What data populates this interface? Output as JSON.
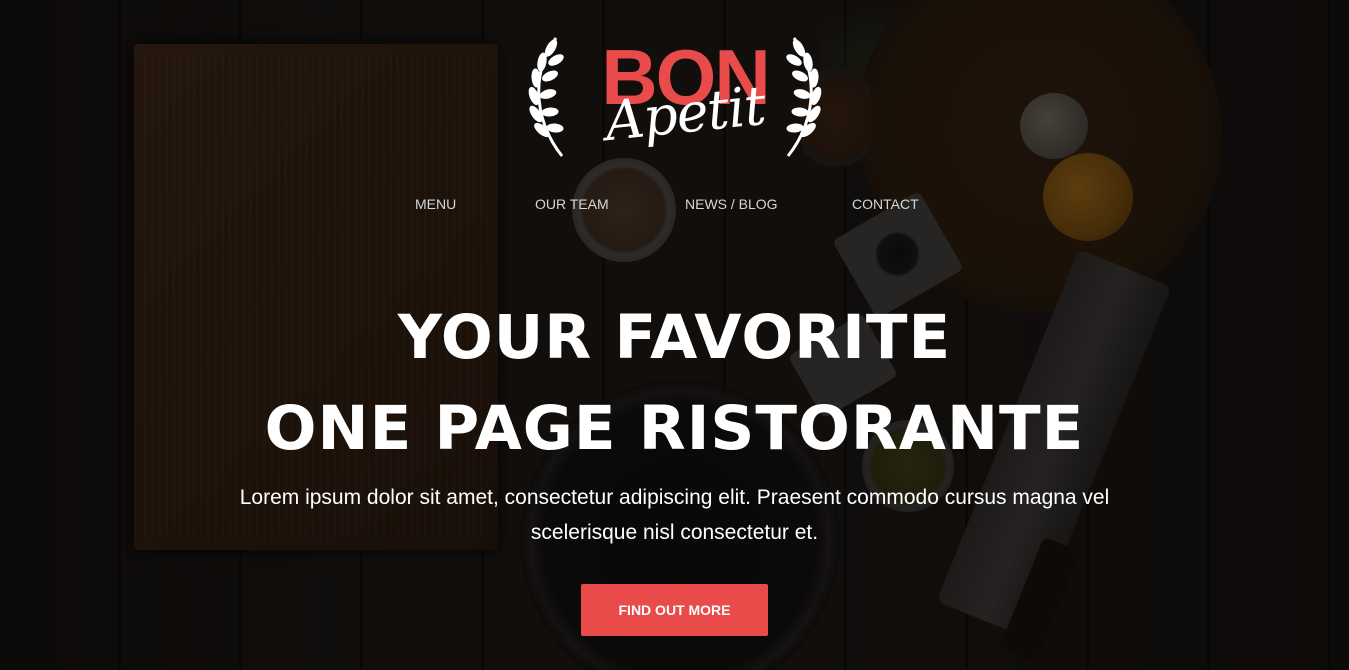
{
  "brand": {
    "logo_main": "BON",
    "logo_script": "Apetit",
    "accent_color": "#e94b4b"
  },
  "nav": {
    "items": [
      {
        "label": "MENU"
      },
      {
        "label": "OUR TEAM"
      },
      {
        "label": "NEWS / BLOG"
      },
      {
        "label": "CONTACT"
      }
    ]
  },
  "hero": {
    "headline_line1": "YOUR FAVORITE",
    "headline_line2": "ONE PAGE RISTORANTE",
    "subtext": "Lorem ipsum dolor sit amet, consectetur adipiscing elit. Praesent commodo cursus magna vel scelerisque nisl consectetur et.",
    "cta_label": "FIND OUT MORE"
  },
  "icons": {
    "logo_wreath": "laurel-wreath-icon"
  }
}
